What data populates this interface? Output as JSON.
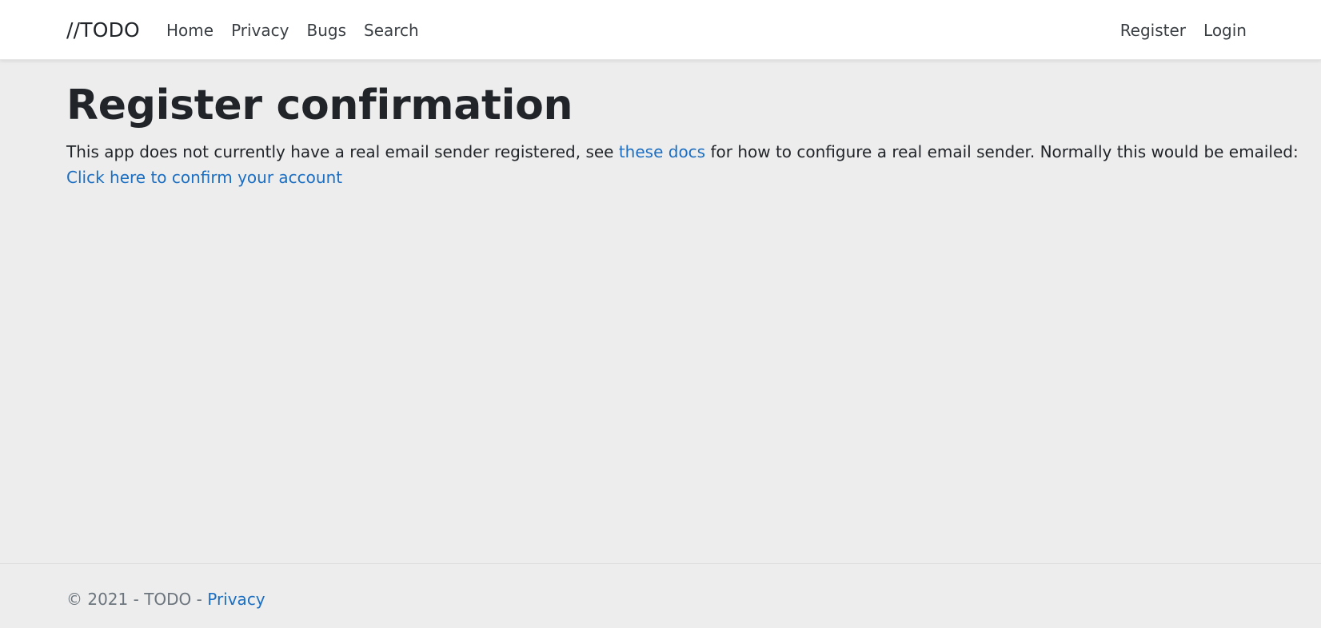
{
  "navbar": {
    "brand": "//TODO",
    "left_links": [
      "Home",
      "Privacy",
      "Bugs",
      "Search"
    ],
    "right_links": [
      "Register",
      "Login"
    ]
  },
  "main": {
    "title": "Register confirmation",
    "message_before": "This app does not currently have a real email sender registered, see ",
    "docs_link": "these docs",
    "message_after": " for how to configure a real email sender. Normally this would be emailed:",
    "confirm_link": "Click here to confirm your account"
  },
  "footer": {
    "copyright": "© 2021 - TODO - ",
    "privacy_link": "Privacy"
  },
  "colors": {
    "link": "#1b6ec2",
    "background": "#ededed",
    "navbar": "#ffffff",
    "muted_text": "#6c757d"
  }
}
